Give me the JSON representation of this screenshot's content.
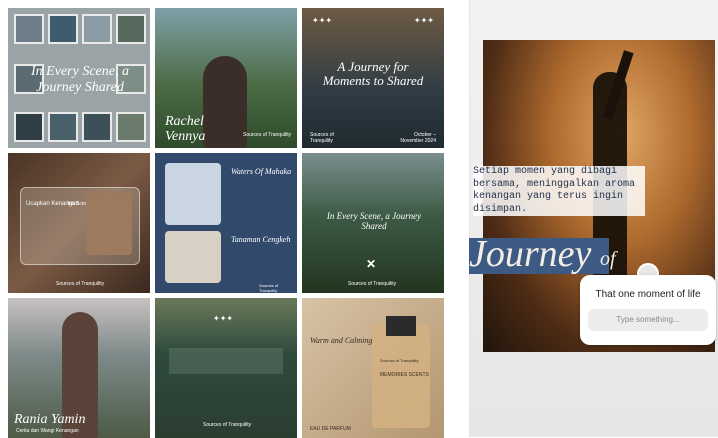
{
  "grid": {
    "tile1": {
      "headline": "In Every Scene, a Journey Shared"
    },
    "tile2": {
      "name": "Rachel Vennya",
      "caption": "Sources of Tranquility"
    },
    "tile3": {
      "stars": "✦✦✦",
      "headline": "A Journey for Moments to Shared",
      "footer_left": "Sources of Tranquility",
      "footer_right": "October – November 2024"
    },
    "tile4": {
      "card_title": "Ucapkan Kenangan",
      "card_tag": "Ink Scents",
      "footer": "Sources of Tranquility"
    },
    "tile5": {
      "title1": "Waters Of Mahaka",
      "title2": "Tanaman Cengkeh",
      "footer": "Sources of Tranquility"
    },
    "tile6": {
      "headline": "In Every Scene, a Journey Shared",
      "footer": "Sources of Tranquility"
    },
    "tile7": {
      "name": "Rania Yamin",
      "caption": "Cerita dan Wangi Kenangan"
    },
    "tile8": {
      "stars": "✦✦✦",
      "footer": "Sources of Tranquility"
    },
    "tile9": {
      "title": "Warm and Calming",
      "bottle_brand": "Sources of Tranquility",
      "bottle_name": "MEMORIES SCENTS",
      "footer": "EAU DE PARFUM"
    }
  },
  "story": {
    "body_text": "Setiap momen yang dibagi bersama, meninggalkan aroma kenangan yang terus ingin disimpan.",
    "headline_big": "Journey",
    "headline_small": "of",
    "question": "That one moment of life",
    "placeholder": "Type something..."
  },
  "colors": {
    "accent_navy": "#2b3e5c",
    "cream": "#f3ede4",
    "brown": "#6b4a33"
  }
}
